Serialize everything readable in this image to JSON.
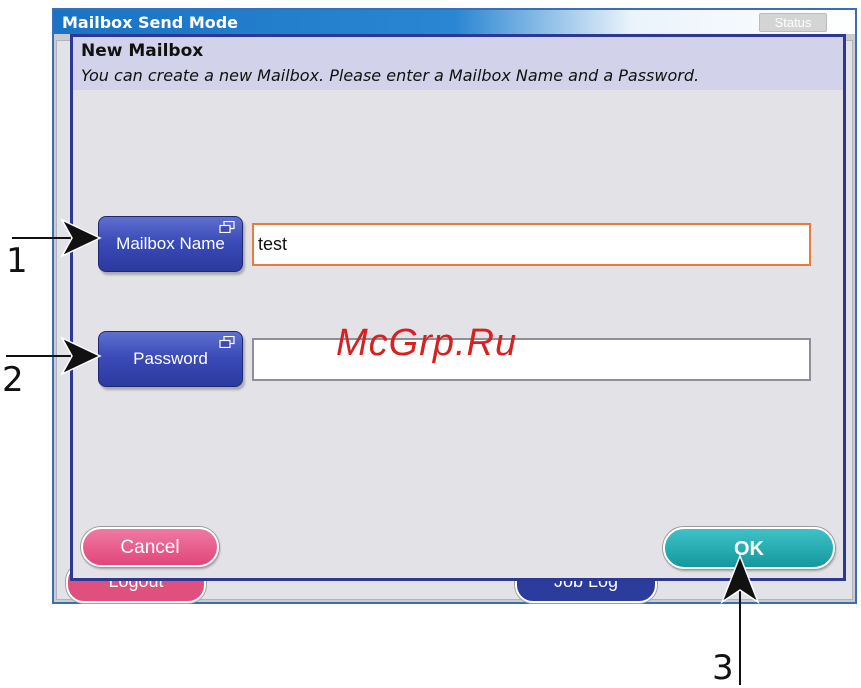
{
  "window": {
    "title": "Mailbox Send Mode",
    "status_label": "Status",
    "background_buttons": {
      "logout_label": "Logout",
      "job_log_label": "Job Log"
    }
  },
  "dialog": {
    "title": "New Mailbox",
    "subtitle": "You can create a new Mailbox. Please enter a Mailbox Name and a Password.",
    "mailbox_name": {
      "button_label": "Mailbox Name",
      "value": "test"
    },
    "password": {
      "button_label": "Password",
      "value": ""
    },
    "cancel_label": "Cancel",
    "ok_label": "OK"
  },
  "watermark": "McGrp.Ru",
  "callouts": [
    "1",
    "2",
    "3"
  ],
  "colors": {
    "titlebar": "#1a73c4",
    "dialog_border": "#2d3796",
    "field_button": "#3b4bb8",
    "cancel": "#e0467a",
    "ok": "#15979e",
    "active_field_border": "#e97a3a"
  }
}
